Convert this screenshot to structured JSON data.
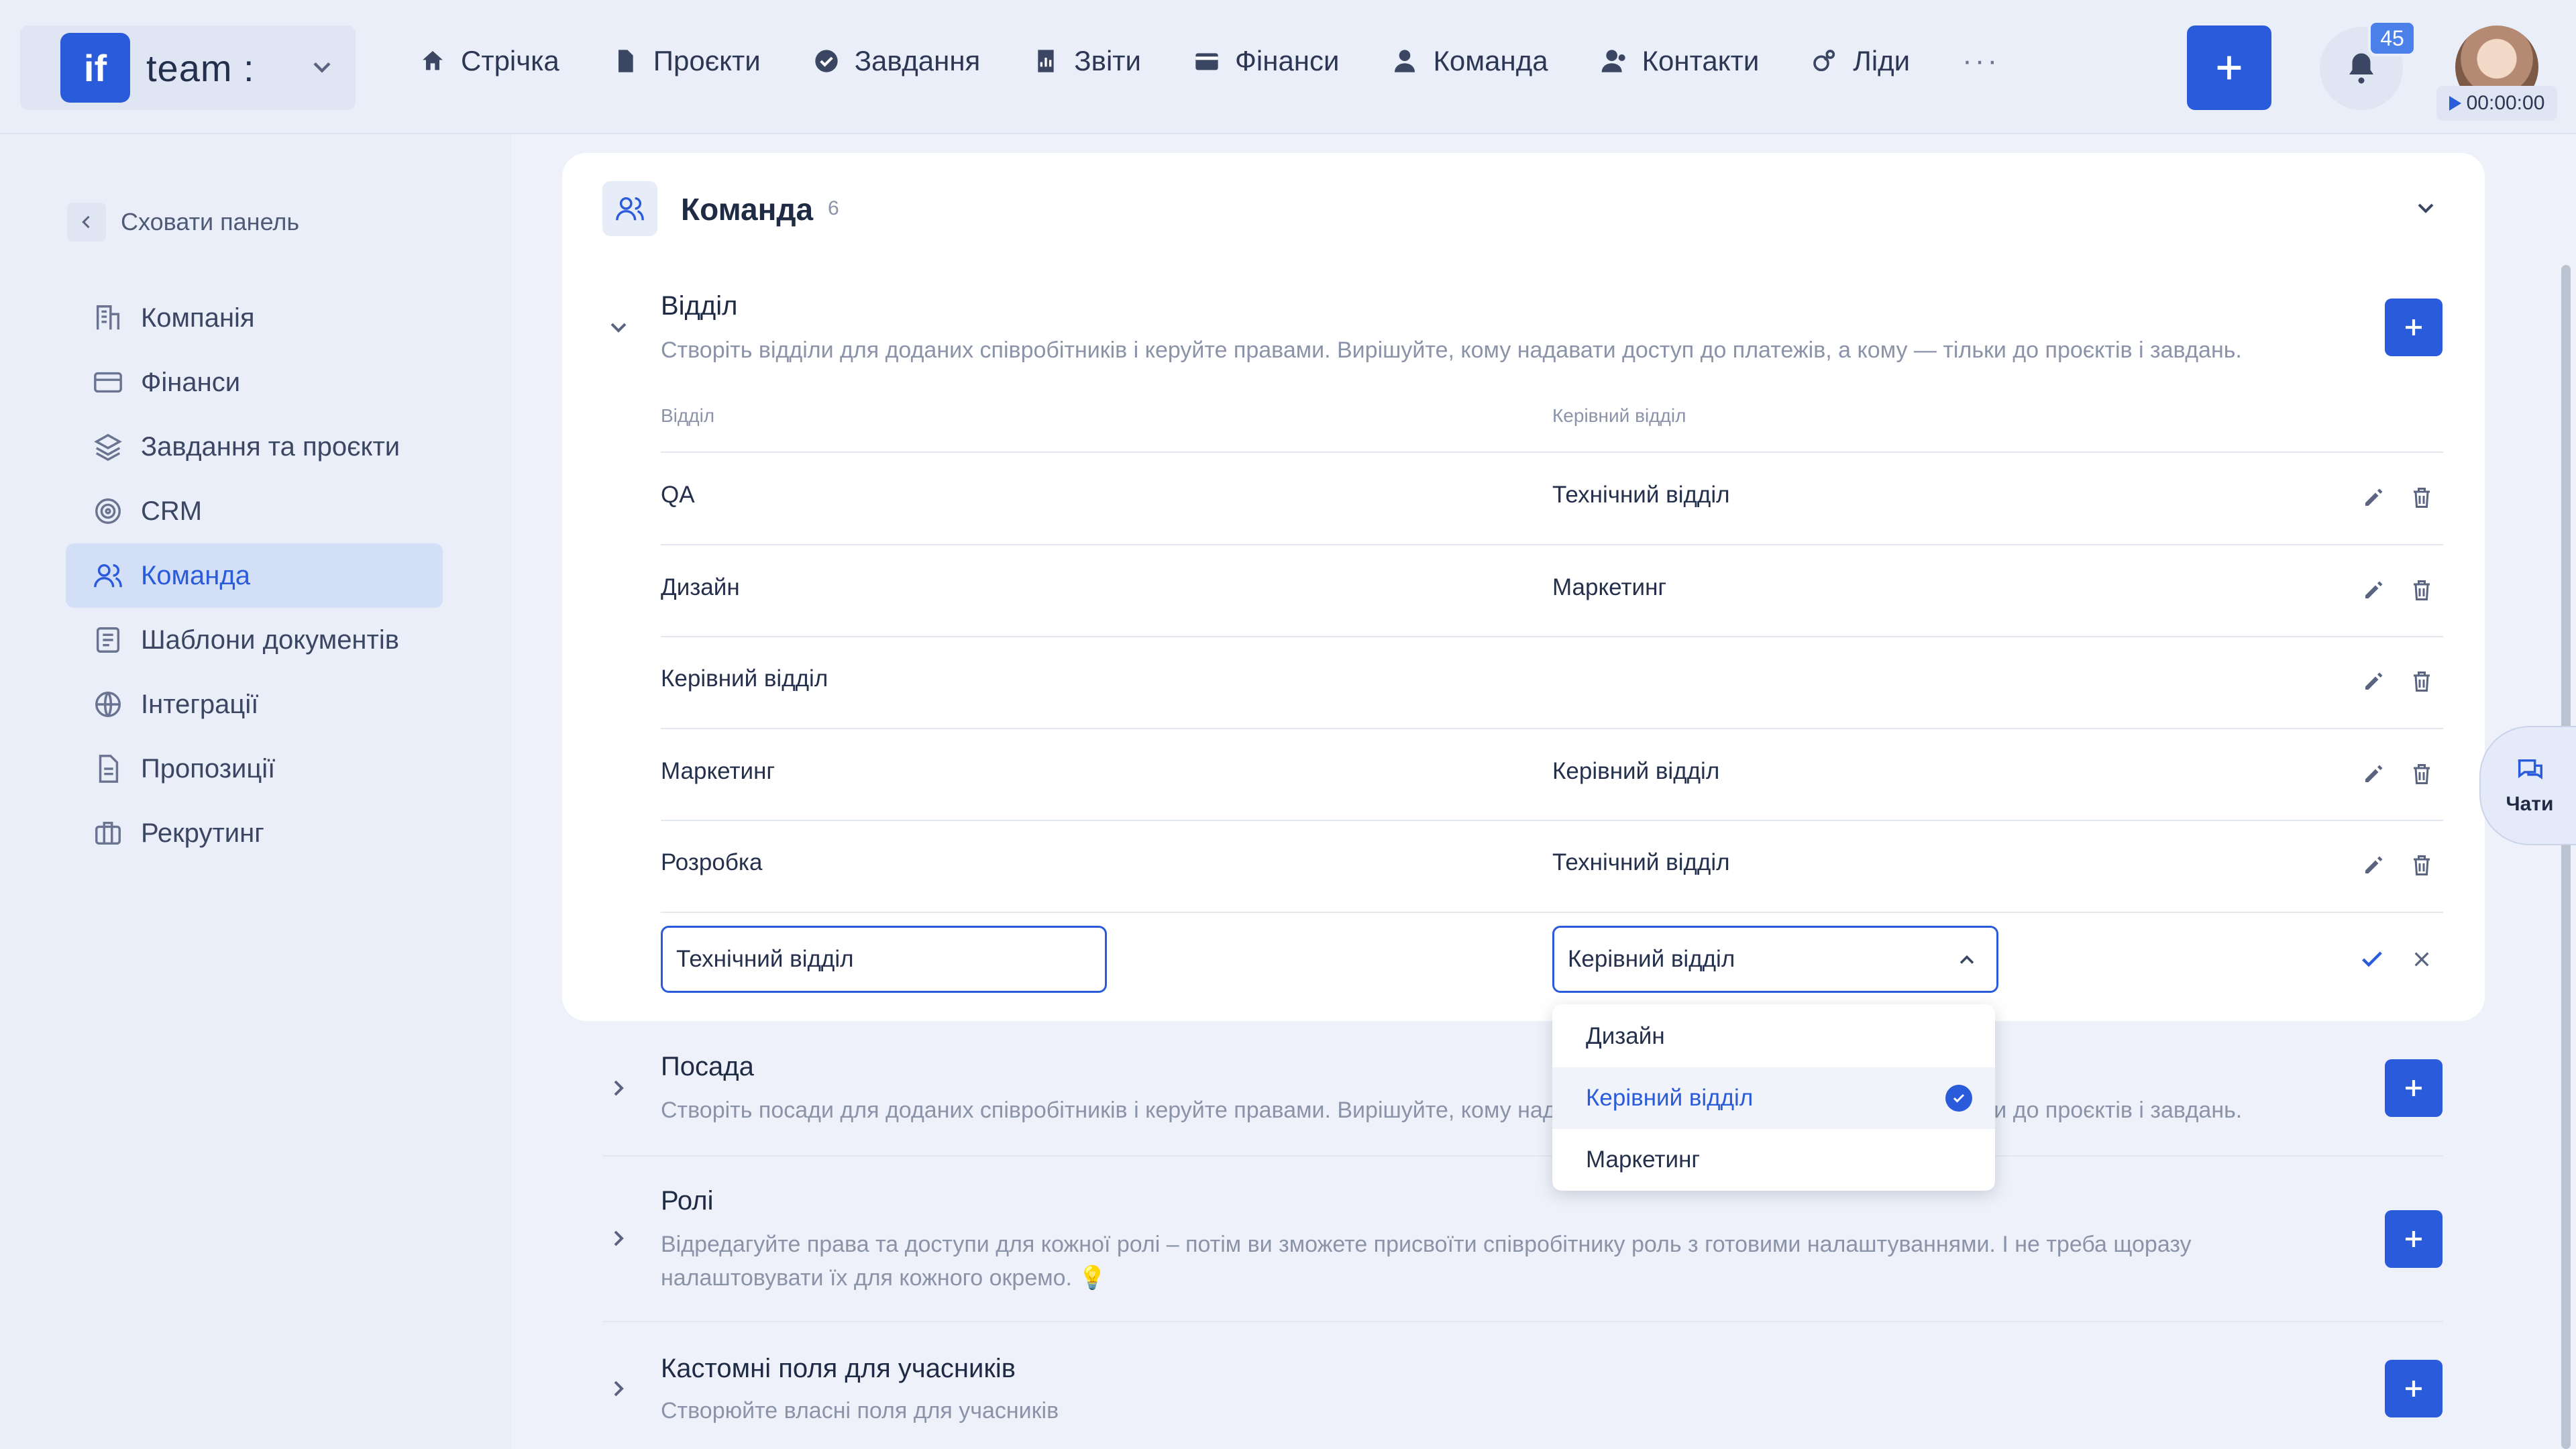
{
  "header": {
    "team_logo": "if",
    "team_name": "team :",
    "nav": [
      {
        "label": "Стрічка",
        "icon": "home-icon"
      },
      {
        "label": "Проєкти",
        "icon": "document-icon"
      },
      {
        "label": "Завдання",
        "icon": "check-circle-icon"
      },
      {
        "label": "Звіти",
        "icon": "report-icon"
      },
      {
        "label": "Фінанси",
        "icon": "wallet-icon"
      },
      {
        "label": "Команда",
        "icon": "user-icon"
      },
      {
        "label": "Контакти",
        "icon": "contacts-icon"
      },
      {
        "label": "Ліди",
        "icon": "leads-icon"
      }
    ],
    "more": "···",
    "notifications_count": "45",
    "timer": "00:00:00"
  },
  "sidebar": {
    "hide_label": "Сховати панель",
    "items": [
      {
        "label": "Компанія",
        "icon": "company-icon"
      },
      {
        "label": "Фінанси",
        "icon": "card-icon"
      },
      {
        "label": "Завдання та проєкти",
        "icon": "layers-icon"
      },
      {
        "label": "CRM",
        "icon": "target-icon"
      },
      {
        "label": "Команда",
        "icon": "team-icon",
        "active": true
      },
      {
        "label": "Шаблони документів",
        "icon": "template-icon"
      },
      {
        "label": "Інтеграції",
        "icon": "globe-icon"
      },
      {
        "label": "Пропозиції",
        "icon": "proposal-icon"
      },
      {
        "label": "Рекрутинг",
        "icon": "briefcase-icon"
      }
    ]
  },
  "card": {
    "title": "Команда",
    "count": "6"
  },
  "department": {
    "title": "Відділ",
    "description": "Створіть відділи для доданих співробітників і керуйте правами. Вирішуйте, кому надавати доступ до платежів, а кому — тільки до проєктів і завдань.",
    "columns": [
      "Відділ",
      "Керівний відділ"
    ],
    "rows": [
      {
        "name": "QA",
        "parent": "Технічний відділ"
      },
      {
        "name": "Дизайн",
        "parent": "Маркетинг"
      },
      {
        "name": "Керівний відділ",
        "parent": ""
      },
      {
        "name": "Маркетинг",
        "parent": "Керівний відділ"
      },
      {
        "name": "Розробка",
        "parent": "Технічний відділ"
      }
    ],
    "edit_row": {
      "name_value": "Технічний відділ",
      "parent_value": "Керівний відділ"
    },
    "dropdown_options": [
      "Дизайн",
      "Керівний відділ",
      "Маркетинг"
    ],
    "dropdown_selected": "Керівний відділ"
  },
  "position": {
    "title": "Посада",
    "description": "Створіть посади для доданих співробітників і керуйте правами. Вирішуйте, кому надавати доступ до платежів, а кому — тільки до проєктів і завдань."
  },
  "roles": {
    "title": "Ролі",
    "description": "Відредагуйте права та доступи для кожної ролі – потім ви зможете присвоїти співробітнику роль з готовими налаштуваннями. І не треба щоразу налаштовувати їх для кожного окремо. 💡"
  },
  "custom_fields": {
    "title": "Кастомні поля для учасників",
    "description": "Створюйте власні поля для учасників"
  },
  "chats": {
    "label": "Чати"
  },
  "colors": {
    "accent": "#2a5bdb",
    "background": "#eef1f9",
    "active_bg": "#d3def7"
  }
}
